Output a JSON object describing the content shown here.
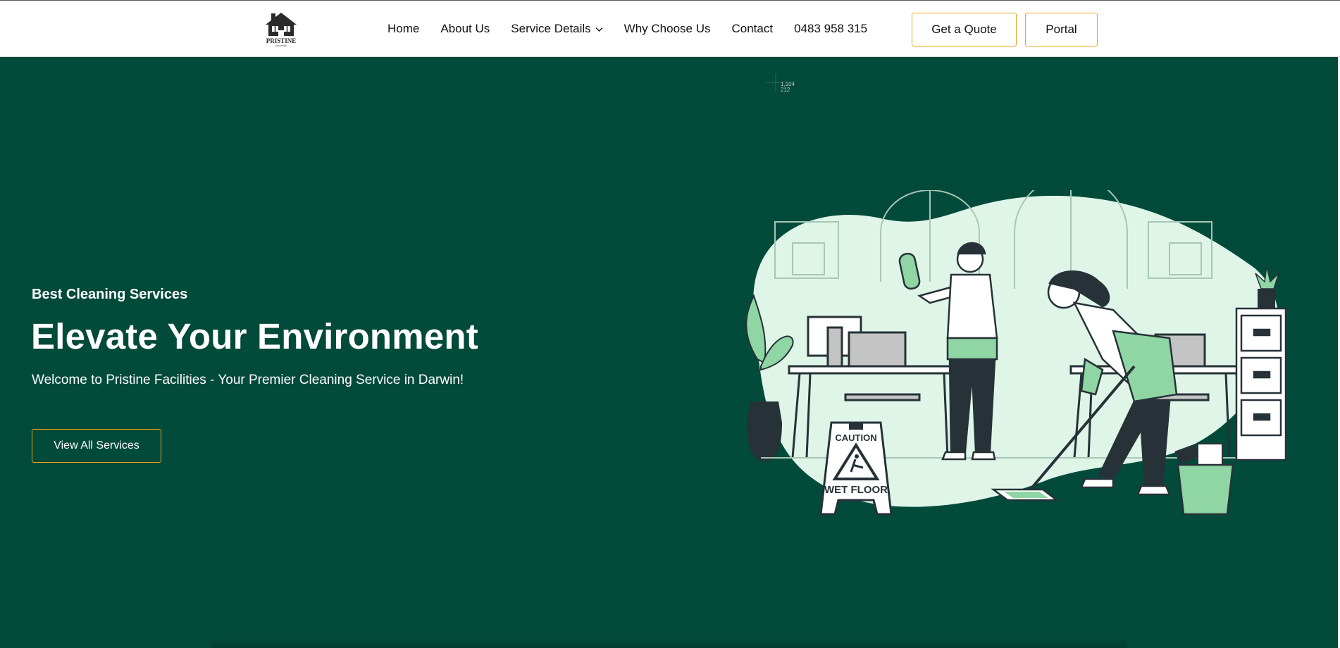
{
  "nav": {
    "logo_icon": "pristine-facilities-logo",
    "logo_text": "PRISTINE",
    "logo_subtext": "FACILITIES",
    "items": [
      {
        "label": "Home"
      },
      {
        "label": "About Us"
      },
      {
        "label": "Service Details",
        "icon": "chevron-down-icon"
      },
      {
        "label": "Why Choose Us"
      },
      {
        "label": "Contact"
      },
      {
        "label": "0483 958 315"
      }
    ],
    "quote_label": "Get a Quote",
    "portal_label": "Portal"
  },
  "hero": {
    "eyebrow": "Best Cleaning Services",
    "headline": "Elevate Your Environment",
    "subtext": "Welcome to Pristine Facilities - Your Premier Cleaning Service in Darwin!",
    "cta_label": "View All Services"
  },
  "illustration": {
    "sign_top": "CAUTION",
    "sign_bottom": "WET FLOOR"
  },
  "cursor": {
    "x_readout": "1,104",
    "y_readout": "212"
  },
  "colors": {
    "hero_bg": "#024a3a",
    "accent": "#e8a317",
    "blob": "#dff5e8",
    "green": "#8fd6a4",
    "dark": "#263238"
  }
}
